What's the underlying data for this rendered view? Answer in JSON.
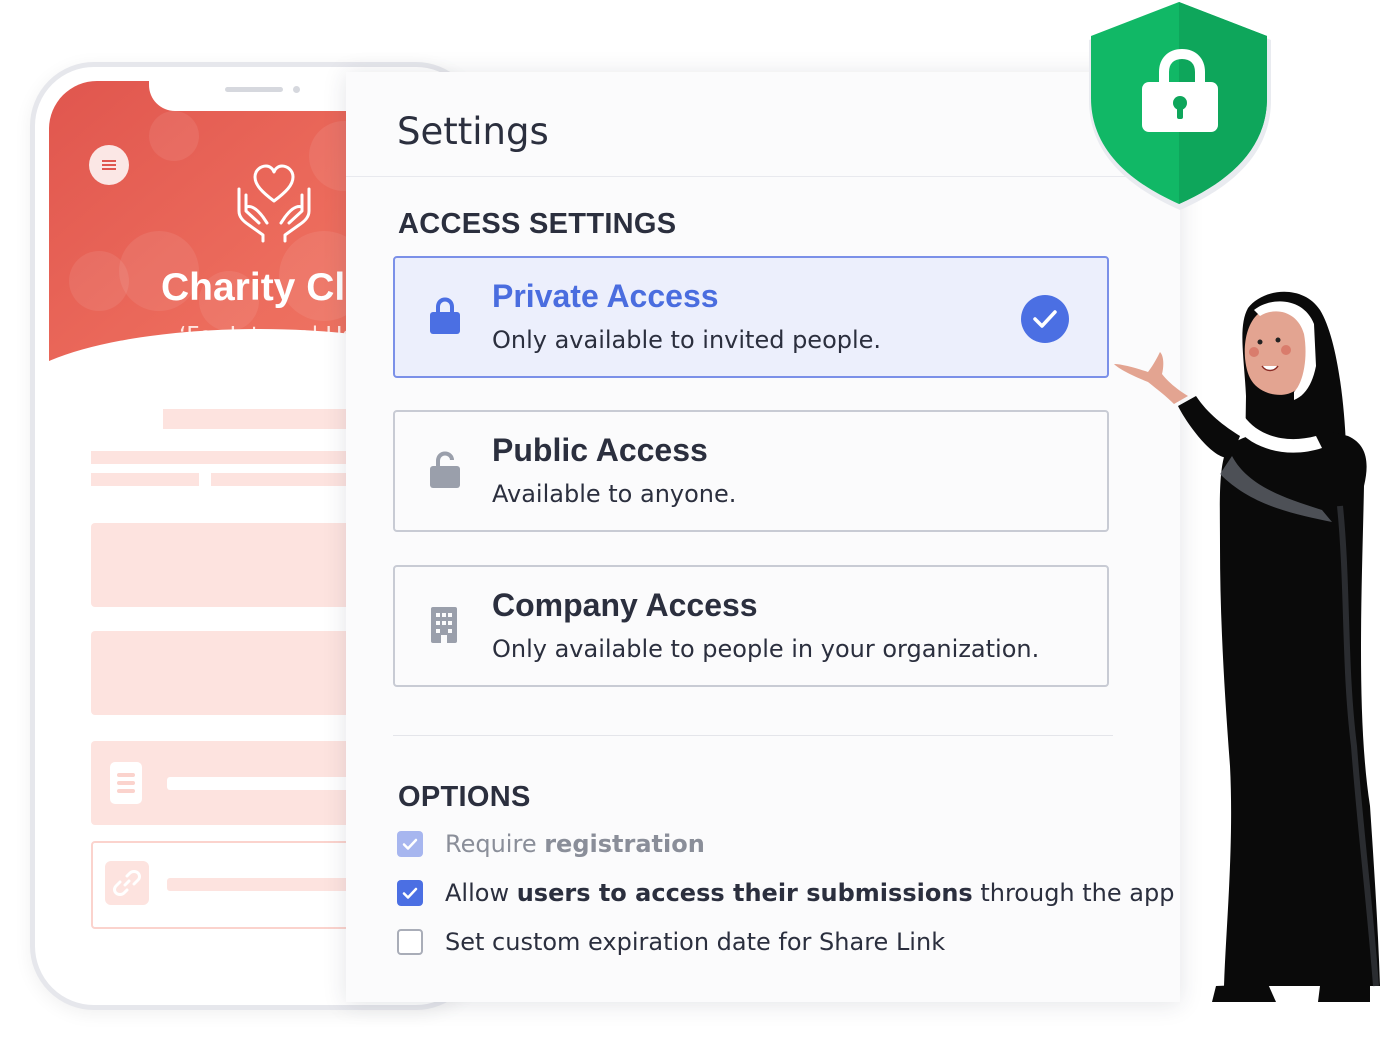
{
  "phone": {
    "app_title": "Charity Clu",
    "app_subtitle": "‘For Internal Use"
  },
  "settings": {
    "title": "Settings",
    "access_heading": "ACCESS SETTINGS",
    "access_options": [
      {
        "title": "Private Access",
        "description": "Only available to invited people.",
        "icon": "lock-icon",
        "selected": true
      },
      {
        "title": "Public Access",
        "description": "Available to anyone.",
        "icon": "unlock-icon",
        "selected": false
      },
      {
        "title": "Company Access",
        "description": "Only available to people in your organization.",
        "icon": "building-icon",
        "selected": false
      }
    ],
    "options_heading": "OPTIONS",
    "options": [
      {
        "prefix": "Require ",
        "bold": "registration",
        "suffix": "",
        "checked": true,
        "disabled": true
      },
      {
        "prefix": "Allow ",
        "bold": "users to access their submissions",
        "suffix": " through the app",
        "checked": true,
        "disabled": false
      },
      {
        "prefix": "Set custom expiration date for Share Link",
        "bold": "",
        "suffix": "",
        "checked": false,
        "disabled": false
      }
    ]
  },
  "colors": {
    "accent": "#4b6fe3",
    "phone_header": "#e0564e",
    "shield": "#10b866"
  },
  "decorations": {
    "shield": "shield-lock-icon",
    "character": "nun-illustration"
  }
}
